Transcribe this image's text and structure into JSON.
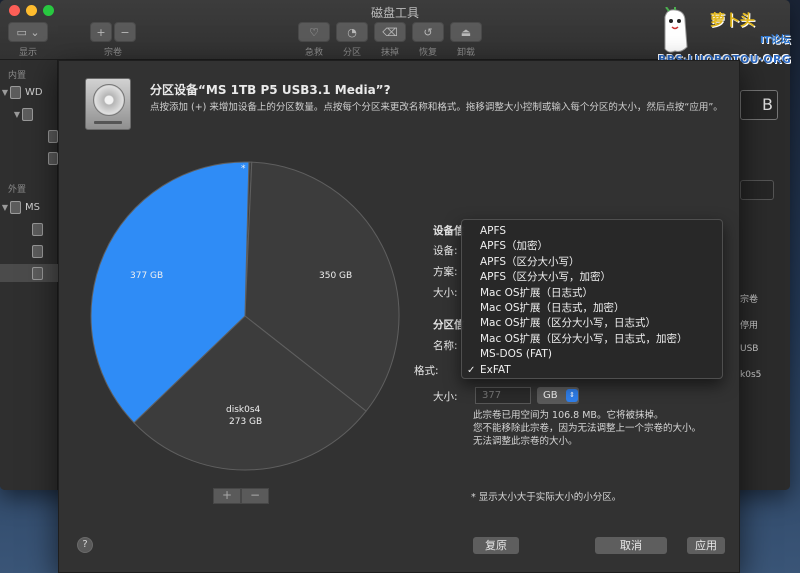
{
  "window": {
    "title": "磁盘工具",
    "toolbar": {
      "view_label": "显示",
      "volume_label": "宗卷",
      "first_aid_label": "急救",
      "partition_label": "分区",
      "erase_label": "抹掉",
      "restore_label": "恢复",
      "unmount_label": "卸载"
    }
  },
  "sidebar": {
    "internal_header": "内置",
    "external_header": "外置",
    "items": [
      {
        "label": "WD"
      },
      {
        "label": ""
      },
      {
        "label": ""
      },
      {
        "label": ""
      },
      {
        "label": "MS"
      },
      {
        "label": ""
      },
      {
        "label": ""
      },
      {
        "label": ""
      }
    ]
  },
  "right_panel": {
    "top_value": "B",
    "rows": [
      "宗卷",
      "停用",
      "USB",
      "k0s5"
    ]
  },
  "sheet": {
    "title": "分区设备“MS 1TB P5 USB3.1 Media”?",
    "description": "点按添加 (+) 来增加设备上的分区数量。点按每个分区来更改名称和格式。拖移调整大小控制或输入每个分区的大小，然后点按“应用”。",
    "pie": {
      "small_marker": "*",
      "slices": [
        {
          "label": "377 GB",
          "value": 377,
          "color": "#2f8cf6",
          "name": ""
        },
        {
          "label": "350 GB",
          "value": 350,
          "color": "#3c3c3c",
          "name": ""
        },
        {
          "label": "273 GB",
          "value": 273,
          "color": "#3c3c3c",
          "name": "disk0s4"
        },
        {
          "label": "",
          "value": 3,
          "color": "#3c3c3c",
          "name": ""
        }
      ]
    },
    "device_info_header": "设备信",
    "device_label": "设备:",
    "scheme_label": "方案:",
    "device_size_label": "大小:",
    "partition_info_header": "分区信",
    "name_label": "名称:",
    "format_label": "格式:",
    "size_label": "大小:",
    "size_value": "377",
    "size_unit": "GB",
    "info_lines": [
      "此宗卷已用空间为 106.8 MB。它将被抹掉。",
      "您不能移除此宗卷，因为无法调整上一个宗卷的大小。",
      "无法调整此宗卷的大小。"
    ],
    "footnote": "* 显示大小大于实际大小的小分区。",
    "help_label": "?",
    "revert_label": "复原",
    "cancel_label": "取消",
    "apply_label": "应用",
    "add_label": "+",
    "remove_label": "−"
  },
  "format_menu": {
    "options": [
      {
        "label": "APFS",
        "checked": false
      },
      {
        "label": "APFS（加密）",
        "checked": false
      },
      {
        "label": "APFS（区分大小写）",
        "checked": false
      },
      {
        "label": "APFS（区分大小写，加密）",
        "checked": false
      },
      {
        "label": "Mac OS扩展（日志式）",
        "checked": false
      },
      {
        "label": "Mac OS扩展（日志式，加密）",
        "checked": false
      },
      {
        "label": "Mac OS扩展（区分大小写，日志式）",
        "checked": false
      },
      {
        "label": "Mac OS扩展（区分大小写，日志式，加密）",
        "checked": false
      },
      {
        "label": "MS-DOS (FAT)",
        "checked": false
      },
      {
        "label": "ExFAT",
        "checked": true
      }
    ],
    "check_glyph": "✓"
  },
  "watermark": {
    "title": "萝卜头",
    "subtitle": "IT论坛",
    "url": "BBS·LUOBOTOU·ORG"
  }
}
